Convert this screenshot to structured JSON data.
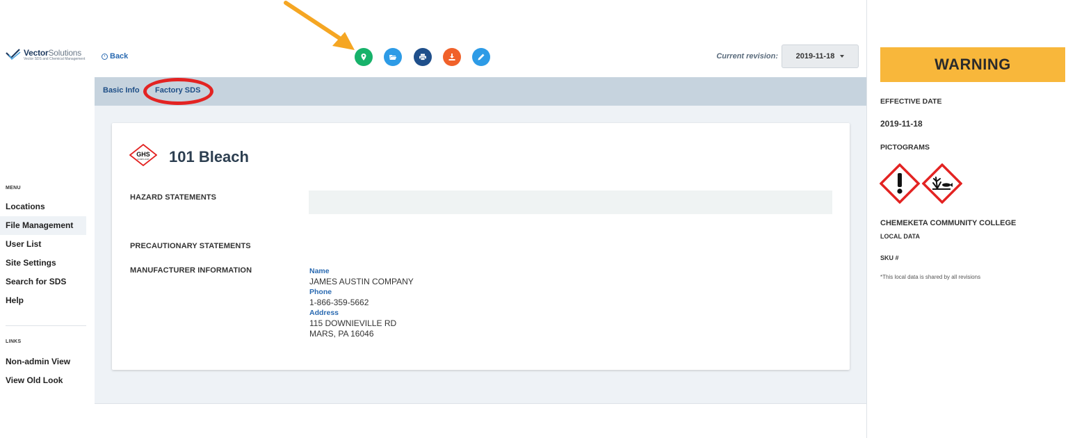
{
  "logo": {
    "brand_bold": "Vector",
    "brand_light": "Solutions",
    "tagline": "Vector SDS and Chemical Management"
  },
  "sidebar": {
    "menu_heading": "MENU",
    "items": [
      {
        "label": "Locations"
      },
      {
        "label": "File Management"
      },
      {
        "label": "User List"
      },
      {
        "label": "Site Settings"
      },
      {
        "label": "Search for SDS"
      },
      {
        "label": "Help"
      }
    ],
    "active_item": "File Management",
    "links_heading": "LINKS",
    "links": [
      {
        "label": "Non-admin View"
      },
      {
        "label": "View Old Look"
      }
    ]
  },
  "topbar": {
    "back_label": "Back",
    "toolbar": [
      {
        "icon": "location-pin-icon",
        "color": "#17b26a"
      },
      {
        "icon": "folder-open-icon",
        "color": "#2d9be6"
      },
      {
        "icon": "print-icon",
        "color": "#1f4f8b"
      },
      {
        "icon": "download-icon",
        "color": "#f0612a"
      },
      {
        "icon": "pencil-icon",
        "color": "#2d9be6"
      }
    ],
    "revision_label": "Current revision:",
    "revision_value": "2019-11-18"
  },
  "tabs": [
    {
      "label": "Basic Info"
    },
    {
      "label": "Factory SDS"
    }
  ],
  "product": {
    "badge_text": "GHS",
    "badge_subtext": "COMPLIANT",
    "name": "101 Bleach",
    "hazard_statements_label": "HAZARD STATEMENTS",
    "precautionary_statements_label": "PRECAUTIONARY STATEMENTS",
    "manufacturer_label": "MANUFACTURER INFORMATION",
    "manufacturer": {
      "name_label": "Name",
      "name": "JAMES AUSTIN COMPANY",
      "phone_label": "Phone",
      "phone": "1-866-359-5662",
      "address_label": "Address",
      "address_line1": "115 DOWNIEVILLE RD",
      "address_line2": "MARS, PA 16046"
    }
  },
  "right_panel": {
    "signal_word": "WARNING",
    "effective_date_label": "EFFECTIVE DATE",
    "effective_date": "2019-11-18",
    "pictograms_label": "PICTOGRAMS",
    "pictograms": [
      "exclamation-mark-pictogram",
      "environment-pictogram"
    ],
    "organization": "CHEMEKETA COMMUNITY COLLEGE",
    "local_data_label": "LOCAL DATA",
    "sku_label": "SKU #",
    "note": "*This local data is shared by all revisions"
  },
  "colors": {
    "warning_banner": "#f8b73b",
    "tabbar": "#c6d3de",
    "annotation_red": "#e32322",
    "annotation_arrow": "#f5a623",
    "link_blue": "#2a6ab1"
  }
}
